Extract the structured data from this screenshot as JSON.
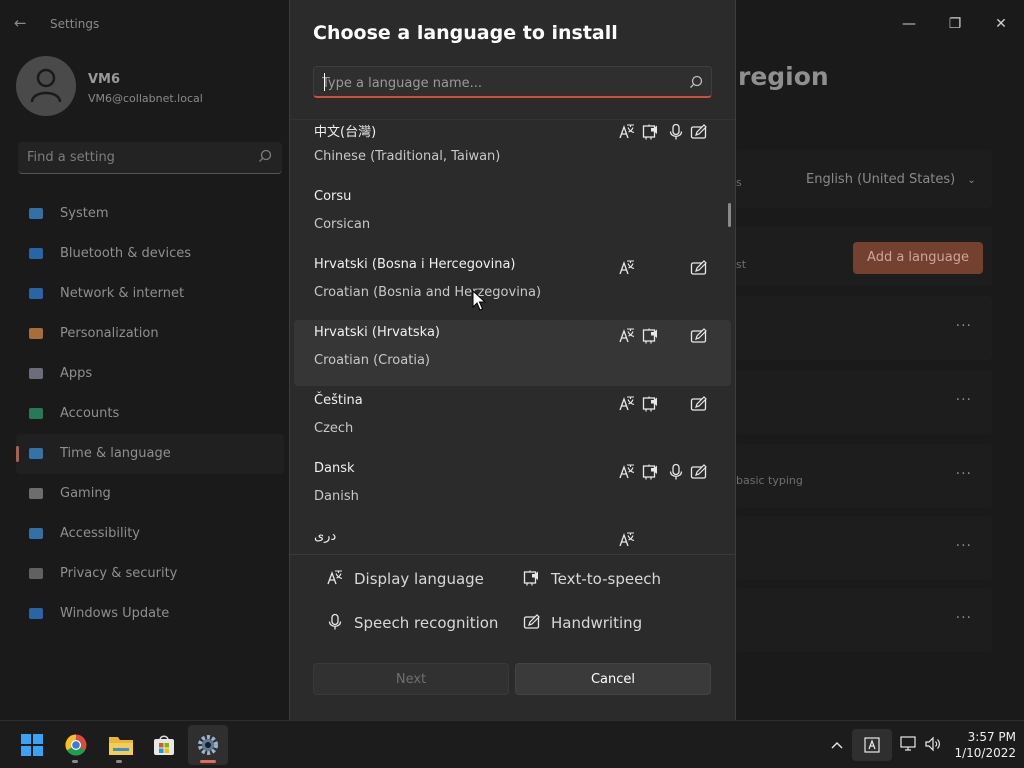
{
  "settings": {
    "app_title": "Settings",
    "user": {
      "name": "VM6",
      "email": "VM6@collabnet.local"
    },
    "search_placeholder": "Find a setting",
    "nav": [
      {
        "label": "System",
        "icon": "system-icon",
        "color": "#3a8fd6"
      },
      {
        "label": "Bluetooth & devices",
        "icon": "bluetooth-icon",
        "color": "#2d7fd4"
      },
      {
        "label": "Network & internet",
        "icon": "wifi-icon",
        "color": "#2d7fd4"
      },
      {
        "label": "Personalization",
        "icon": "brush-icon",
        "color": "#d88a4a"
      },
      {
        "label": "Apps",
        "icon": "apps-icon",
        "color": "#8a8a9a"
      },
      {
        "label": "Accounts",
        "icon": "person-icon",
        "color": "#2e9a6e"
      },
      {
        "label": "Time & language",
        "icon": "globe-clock-icon",
        "color": "#3a8fd6"
      },
      {
        "label": "Gaming",
        "icon": "gamepad-icon",
        "color": "#8a8a8a"
      },
      {
        "label": "Accessibility",
        "icon": "accessibility-icon",
        "color": "#3a8fd6"
      },
      {
        "label": "Privacy & security",
        "icon": "shield-icon",
        "color": "#7a7a7a"
      },
      {
        "label": "Windows Update",
        "icon": "update-icon",
        "color": "#2d7fd4"
      }
    ],
    "active_nav": "Time & language",
    "page_title_partial": "region",
    "row_fragments": [
      "s",
      "st",
      "basic typing"
    ],
    "display_language_value": "English (United States)",
    "add_language_label": "Add a language",
    "more_label": "···"
  },
  "dialog": {
    "title": "Choose a language to install",
    "search_placeholder": "Type a language name...",
    "languages": [
      {
        "native": "中文(台灣)",
        "english": "Chinese (Traditional, Taiwan)",
        "display": true,
        "tts": true,
        "speech": true,
        "handwriting": true
      },
      {
        "native": "Corsu",
        "english": "Corsican",
        "display": false,
        "tts": false,
        "speech": false,
        "handwriting": false
      },
      {
        "native": "Hrvatski (Bosna i Hercegovina)",
        "english": "Croatian (Bosnia and Herzegovina)",
        "display": true,
        "tts": false,
        "speech": false,
        "handwriting": true
      },
      {
        "native": "Hrvatski (Hrvatska)",
        "english": "Croatian (Croatia)",
        "display": true,
        "tts": true,
        "speech": false,
        "handwriting": true,
        "hovered": true
      },
      {
        "native": "Čeština",
        "english": "Czech",
        "display": true,
        "tts": true,
        "speech": false,
        "handwriting": true
      },
      {
        "native": "Dansk",
        "english": "Danish",
        "display": true,
        "tts": true,
        "speech": true,
        "handwriting": true
      },
      {
        "native": "دری",
        "english": "",
        "display": true,
        "tts": false,
        "speech": false,
        "handwriting": false
      }
    ],
    "legend": {
      "display": "Display language",
      "tts": "Text-to-speech",
      "speech": "Speech recognition",
      "handwriting": "Handwriting"
    },
    "next_label": "Next",
    "cancel_label": "Cancel"
  },
  "taskbar": {
    "apps": [
      "start-icon",
      "chrome-icon",
      "file-explorer-icon",
      "store-icon",
      "settings-icon"
    ],
    "time": "3:57 PM",
    "date": "1/10/2022"
  }
}
